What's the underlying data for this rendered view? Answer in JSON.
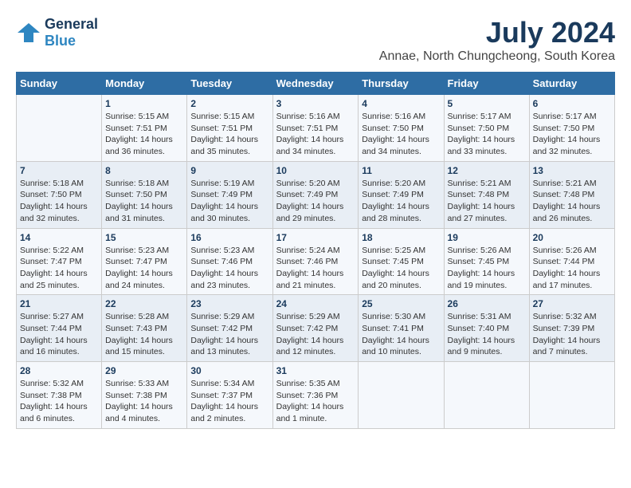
{
  "header": {
    "logo_line1": "General",
    "logo_line2": "Blue",
    "month_title": "July 2024",
    "subtitle": "Annae, North Chungcheong, South Korea"
  },
  "weekdays": [
    "Sunday",
    "Monday",
    "Tuesday",
    "Wednesday",
    "Thursday",
    "Friday",
    "Saturday"
  ],
  "weeks": [
    [
      {
        "day": "",
        "sunrise": "",
        "sunset": "",
        "daylight": ""
      },
      {
        "day": "1",
        "sunrise": "Sunrise: 5:15 AM",
        "sunset": "Sunset: 7:51 PM",
        "daylight": "Daylight: 14 hours and 36 minutes."
      },
      {
        "day": "2",
        "sunrise": "Sunrise: 5:15 AM",
        "sunset": "Sunset: 7:51 PM",
        "daylight": "Daylight: 14 hours and 35 minutes."
      },
      {
        "day": "3",
        "sunrise": "Sunrise: 5:16 AM",
        "sunset": "Sunset: 7:51 PM",
        "daylight": "Daylight: 14 hours and 34 minutes."
      },
      {
        "day": "4",
        "sunrise": "Sunrise: 5:16 AM",
        "sunset": "Sunset: 7:50 PM",
        "daylight": "Daylight: 14 hours and 34 minutes."
      },
      {
        "day": "5",
        "sunrise": "Sunrise: 5:17 AM",
        "sunset": "Sunset: 7:50 PM",
        "daylight": "Daylight: 14 hours and 33 minutes."
      },
      {
        "day": "6",
        "sunrise": "Sunrise: 5:17 AM",
        "sunset": "Sunset: 7:50 PM",
        "daylight": "Daylight: 14 hours and 32 minutes."
      }
    ],
    [
      {
        "day": "7",
        "sunrise": "Sunrise: 5:18 AM",
        "sunset": "Sunset: 7:50 PM",
        "daylight": "Daylight: 14 hours and 32 minutes."
      },
      {
        "day": "8",
        "sunrise": "Sunrise: 5:18 AM",
        "sunset": "Sunset: 7:50 PM",
        "daylight": "Daylight: 14 hours and 31 minutes."
      },
      {
        "day": "9",
        "sunrise": "Sunrise: 5:19 AM",
        "sunset": "Sunset: 7:49 PM",
        "daylight": "Daylight: 14 hours and 30 minutes."
      },
      {
        "day": "10",
        "sunrise": "Sunrise: 5:20 AM",
        "sunset": "Sunset: 7:49 PM",
        "daylight": "Daylight: 14 hours and 29 minutes."
      },
      {
        "day": "11",
        "sunrise": "Sunrise: 5:20 AM",
        "sunset": "Sunset: 7:49 PM",
        "daylight": "Daylight: 14 hours and 28 minutes."
      },
      {
        "day": "12",
        "sunrise": "Sunrise: 5:21 AM",
        "sunset": "Sunset: 7:48 PM",
        "daylight": "Daylight: 14 hours and 27 minutes."
      },
      {
        "day": "13",
        "sunrise": "Sunrise: 5:21 AM",
        "sunset": "Sunset: 7:48 PM",
        "daylight": "Daylight: 14 hours and 26 minutes."
      }
    ],
    [
      {
        "day": "14",
        "sunrise": "Sunrise: 5:22 AM",
        "sunset": "Sunset: 7:47 PM",
        "daylight": "Daylight: 14 hours and 25 minutes."
      },
      {
        "day": "15",
        "sunrise": "Sunrise: 5:23 AM",
        "sunset": "Sunset: 7:47 PM",
        "daylight": "Daylight: 14 hours and 24 minutes."
      },
      {
        "day": "16",
        "sunrise": "Sunrise: 5:23 AM",
        "sunset": "Sunset: 7:46 PM",
        "daylight": "Daylight: 14 hours and 23 minutes."
      },
      {
        "day": "17",
        "sunrise": "Sunrise: 5:24 AM",
        "sunset": "Sunset: 7:46 PM",
        "daylight": "Daylight: 14 hours and 21 minutes."
      },
      {
        "day": "18",
        "sunrise": "Sunrise: 5:25 AM",
        "sunset": "Sunset: 7:45 PM",
        "daylight": "Daylight: 14 hours and 20 minutes."
      },
      {
        "day": "19",
        "sunrise": "Sunrise: 5:26 AM",
        "sunset": "Sunset: 7:45 PM",
        "daylight": "Daylight: 14 hours and 19 minutes."
      },
      {
        "day": "20",
        "sunrise": "Sunrise: 5:26 AM",
        "sunset": "Sunset: 7:44 PM",
        "daylight": "Daylight: 14 hours and 17 minutes."
      }
    ],
    [
      {
        "day": "21",
        "sunrise": "Sunrise: 5:27 AM",
        "sunset": "Sunset: 7:44 PM",
        "daylight": "Daylight: 14 hours and 16 minutes."
      },
      {
        "day": "22",
        "sunrise": "Sunrise: 5:28 AM",
        "sunset": "Sunset: 7:43 PM",
        "daylight": "Daylight: 14 hours and 15 minutes."
      },
      {
        "day": "23",
        "sunrise": "Sunrise: 5:29 AM",
        "sunset": "Sunset: 7:42 PM",
        "daylight": "Daylight: 14 hours and 13 minutes."
      },
      {
        "day": "24",
        "sunrise": "Sunrise: 5:29 AM",
        "sunset": "Sunset: 7:42 PM",
        "daylight": "Daylight: 14 hours and 12 minutes."
      },
      {
        "day": "25",
        "sunrise": "Sunrise: 5:30 AM",
        "sunset": "Sunset: 7:41 PM",
        "daylight": "Daylight: 14 hours and 10 minutes."
      },
      {
        "day": "26",
        "sunrise": "Sunrise: 5:31 AM",
        "sunset": "Sunset: 7:40 PM",
        "daylight": "Daylight: 14 hours and 9 minutes."
      },
      {
        "day": "27",
        "sunrise": "Sunrise: 5:32 AM",
        "sunset": "Sunset: 7:39 PM",
        "daylight": "Daylight: 14 hours and 7 minutes."
      }
    ],
    [
      {
        "day": "28",
        "sunrise": "Sunrise: 5:32 AM",
        "sunset": "Sunset: 7:38 PM",
        "daylight": "Daylight: 14 hours and 6 minutes."
      },
      {
        "day": "29",
        "sunrise": "Sunrise: 5:33 AM",
        "sunset": "Sunset: 7:38 PM",
        "daylight": "Daylight: 14 hours and 4 minutes."
      },
      {
        "day": "30",
        "sunrise": "Sunrise: 5:34 AM",
        "sunset": "Sunset: 7:37 PM",
        "daylight": "Daylight: 14 hours and 2 minutes."
      },
      {
        "day": "31",
        "sunrise": "Sunrise: 5:35 AM",
        "sunset": "Sunset: 7:36 PM",
        "daylight": "Daylight: 14 hours and 1 minute."
      },
      {
        "day": "",
        "sunrise": "",
        "sunset": "",
        "daylight": ""
      },
      {
        "day": "",
        "sunrise": "",
        "sunset": "",
        "daylight": ""
      },
      {
        "day": "",
        "sunrise": "",
        "sunset": "",
        "daylight": ""
      }
    ]
  ]
}
